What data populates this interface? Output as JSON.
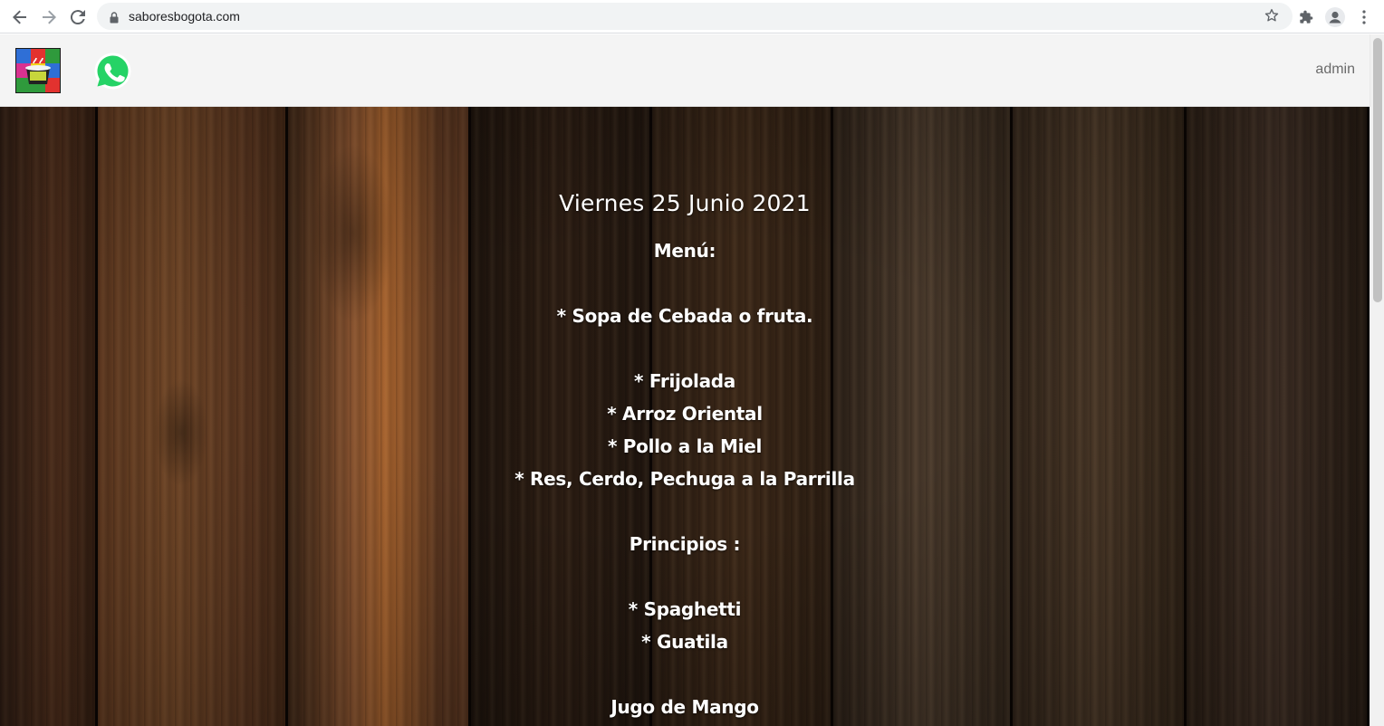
{
  "browser": {
    "url": "saboresbogota.com"
  },
  "header": {
    "admin_label": "admin"
  },
  "menu": {
    "date": "Viernes 25 Junio 2021",
    "heading": "Menú:",
    "soup": "* Sopa de Cebada o fruta.",
    "mains": [
      "* Frijolada",
      "* Arroz Oriental",
      "* Pollo a la Miel",
      "* Res, Cerdo, Pechuga a la Parrilla"
    ],
    "principios_heading": "Principios :",
    "principios": [
      "* Spaghetti",
      "* Guatila"
    ],
    "drink": "Jugo de Mango"
  },
  "colors": {
    "header_bg": "#f4f4f4",
    "admin_text": "#6a6a6a",
    "menu_text": "#ffffff",
    "whatsapp_green": "#25d366"
  },
  "icons": [
    "back-icon",
    "forward-icon",
    "reload-icon",
    "lock-icon",
    "star-icon",
    "extensions-icon",
    "profile-icon",
    "more-icon",
    "logo",
    "whatsapp-icon"
  ]
}
